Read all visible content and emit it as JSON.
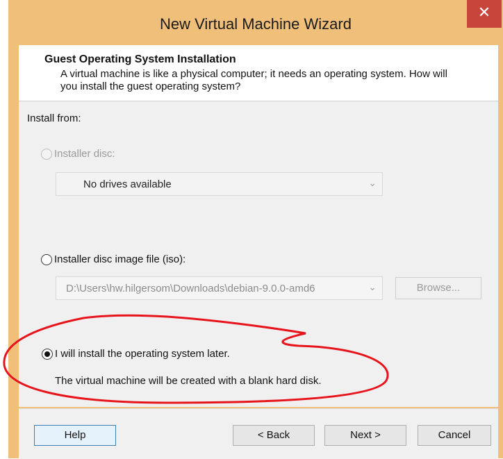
{
  "window": {
    "title": "New Virtual Machine Wizard",
    "close_glyph": "✕"
  },
  "header": {
    "title": "Guest Operating System Installation",
    "description": "A virtual machine is like a physical computer; it needs an operating system. How will you install the guest operating system?"
  },
  "body": {
    "install_from_label": "Install from:",
    "option_disc": {
      "label": "Installer disc:",
      "selected": false,
      "enabled": false,
      "dropdown_value": "No drives available"
    },
    "option_iso": {
      "label": "Installer disc image file (iso):",
      "selected": false,
      "enabled": true,
      "path_value": "D:\\Users\\hw.hilgersom\\Downloads\\debian-9.0.0-amd6",
      "browse_label": "Browse..."
    },
    "option_later": {
      "label": "I will install the operating system later.",
      "selected": true,
      "description": "The virtual machine will be created with a blank hard disk."
    }
  },
  "footer": {
    "help_label": "Help",
    "back_label": "< Back",
    "next_label": "Next >",
    "cancel_label": "Cancel"
  },
  "colors": {
    "titlebar": "#f0c07a",
    "close_button": "#c7453b",
    "annotation": "#e8141c"
  },
  "icons": {
    "close": "close-icon",
    "dropdown": "chevron-down-icon"
  }
}
